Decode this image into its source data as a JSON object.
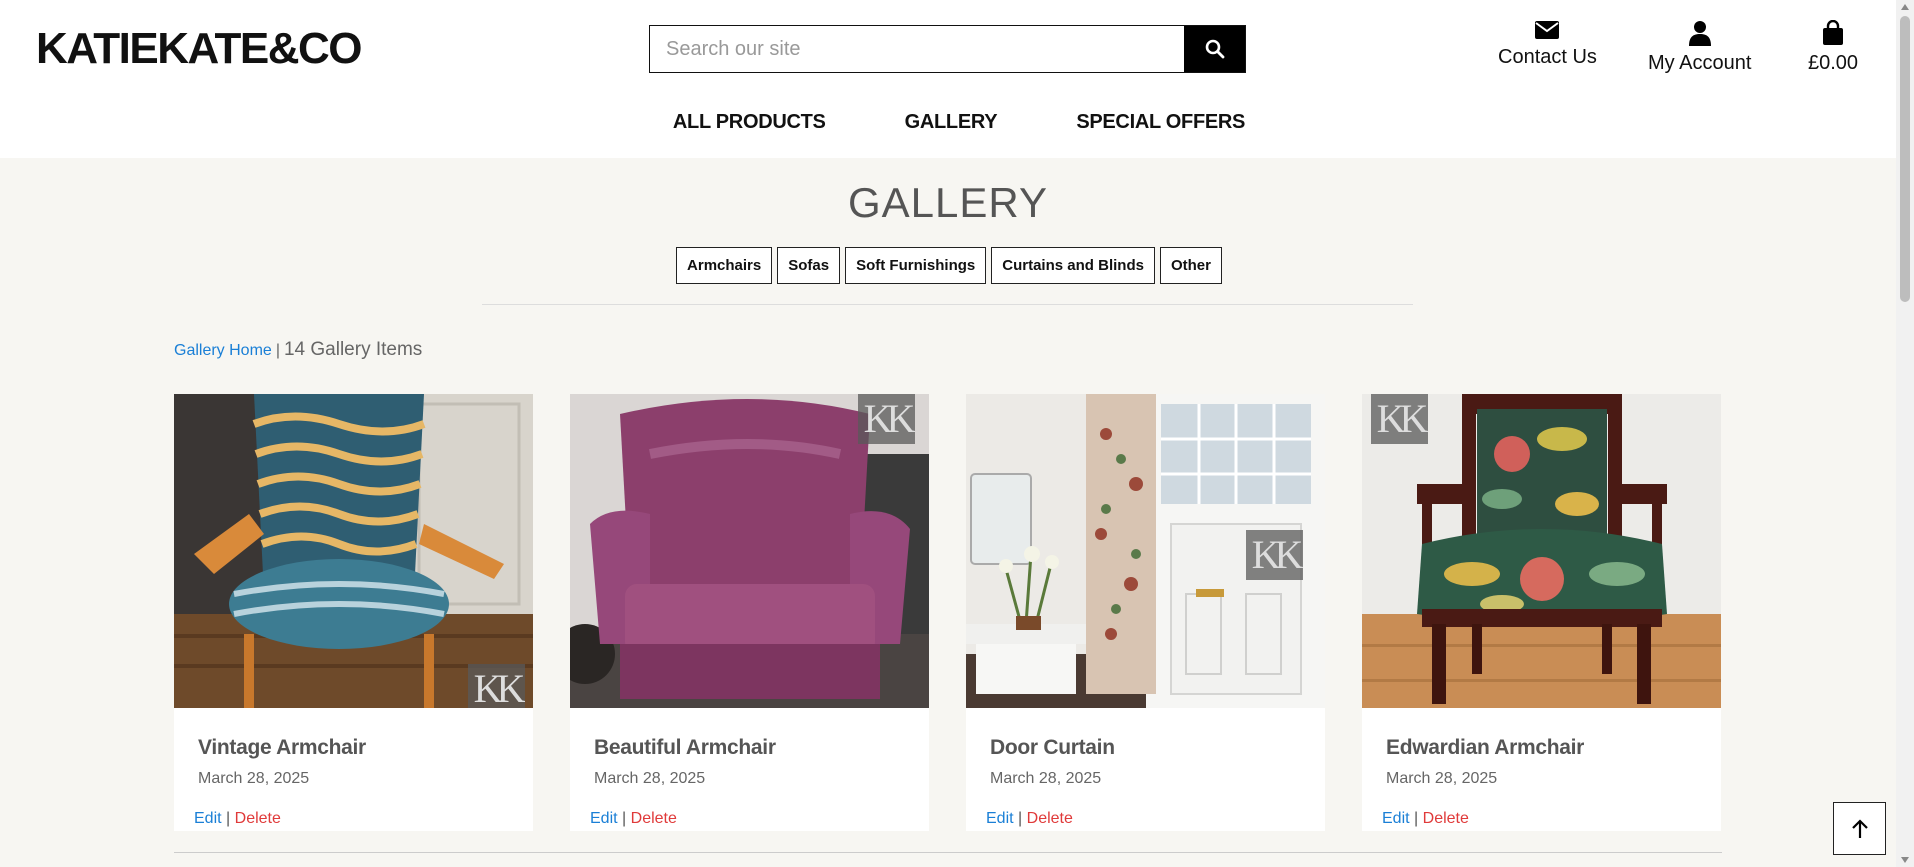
{
  "header": {
    "logo": "KATIEKATE&CO",
    "search_placeholder": "Search our site",
    "contact_label": "Contact Us",
    "account_label": "My Account",
    "cart_total": "£0.00"
  },
  "nav": {
    "items": [
      "ALL PRODUCTS",
      "GALLERY",
      "SPECIAL OFFERS"
    ]
  },
  "page": {
    "title": "GALLERY",
    "filters": [
      "Armchairs",
      "Sofas",
      "Soft Furnishings",
      "Curtains and Blinds",
      "Other"
    ],
    "breadcrumb_home": "Gallery Home",
    "breadcrumb_sep": "|",
    "item_count": "14 Gallery Items"
  },
  "cards": [
    {
      "title": "Vintage Armchair",
      "date": "March 28, 2025",
      "edit": "Edit",
      "delete": "Delete",
      "sep": "|"
    },
    {
      "title": "Beautiful Armchair",
      "date": "March 28, 2025",
      "edit": "Edit",
      "delete": "Delete",
      "sep": "|"
    },
    {
      "title": "Door Curtain",
      "date": "March 28, 2025",
      "edit": "Edit",
      "delete": "Delete",
      "sep": "|"
    },
    {
      "title": "Edwardian Armchair",
      "date": "March 28, 2025",
      "edit": "Edit",
      "delete": "Delete",
      "sep": "|"
    }
  ],
  "watermark": "KK",
  "colors": {
    "link_blue": "#1a7fd6",
    "delete_red": "#e03a3a",
    "page_bg": "#f7f6f2"
  }
}
